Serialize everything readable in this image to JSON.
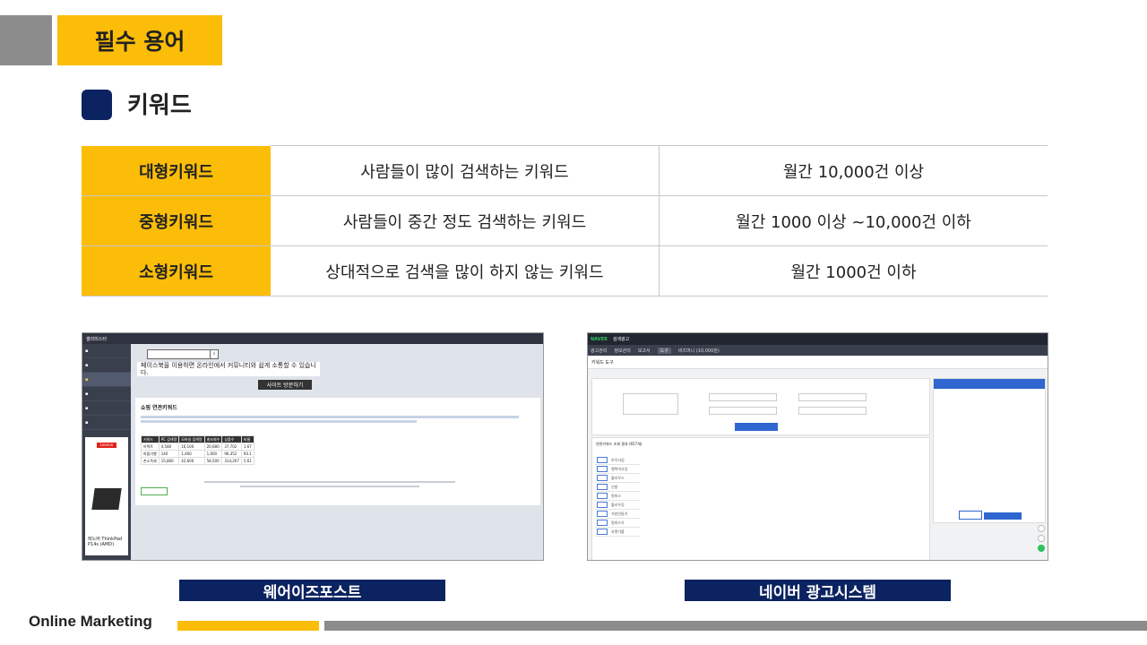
{
  "header": {
    "title": "필수 용어"
  },
  "section": {
    "title": "키워드"
  },
  "terms_table": {
    "rows": [
      {
        "keyword": "대형키워드",
        "description": "사람들이 많이 검색하는 키워드",
        "volume": "월간 10,000건 이상"
      },
      {
        "keyword": "중형키워드",
        "description": "사람들이 중간 정도 검색하는 키워드",
        "volume": "월간 1000 이상 ~10,000건 이하"
      },
      {
        "keyword": "소형키워드",
        "description": "상대적으로 검색을 많이 하지 않는 키워드",
        "volume": "월간 1000건 이하"
      }
    ]
  },
  "screenshots": {
    "left": {
      "caption": "웨어이즈포스트",
      "brand": "셀리미스터",
      "banner_text": "페이스북을 이용하면 온라인에서 커뮤니티와 쉽게 소통할 수 있습니다.",
      "banner_button": "사이트 방문하기",
      "card_title": "쇼핑 연관키워드",
      "ad_brand": "Lenovo",
      "ad_text": "레노버 ThinkPad P14s (AMD)",
      "table_headers": [
        "키워드",
        "PC 검색량",
        "모바일 검색량",
        "총조회수",
        "상품수",
        "비율"
      ],
      "table_rows": [
        [
          "아텍트",
          "4,580",
          "16,100",
          "20,680",
          "37,702",
          "1.67"
        ],
        [
          "마을기행",
          "140",
          "1,460",
          "1,600",
          "96,352",
          "60.1"
        ],
        [
          "손소독제",
          "15,800",
          "42,600",
          "58,500",
          "314,207",
          "5.61"
        ]
      ]
    },
    "right": {
      "caption": "네이버 광고시스템",
      "brand": "NAVER",
      "brand_suffix": "검색광고",
      "nav_items": [
        "광고관리",
        "정보관리",
        "보고서",
        "도구",
        "비즈머니 (10,000원)"
      ],
      "tool_title": "키워드 도구",
      "result_title": "연관키워드 조회 결과 (657개)",
      "result_rows": [
        "아이사업",
        "행복미사업",
        "블라우스",
        "신발",
        "원피스",
        "블라우징",
        "가방만들기",
        "원피스가",
        "자켓가를"
      ]
    }
  },
  "footer": {
    "text": "Online Marketing"
  },
  "colors": {
    "accent_yellow": "#fbbd08",
    "navy": "#0c2361",
    "gray": "#8c8c8c"
  }
}
